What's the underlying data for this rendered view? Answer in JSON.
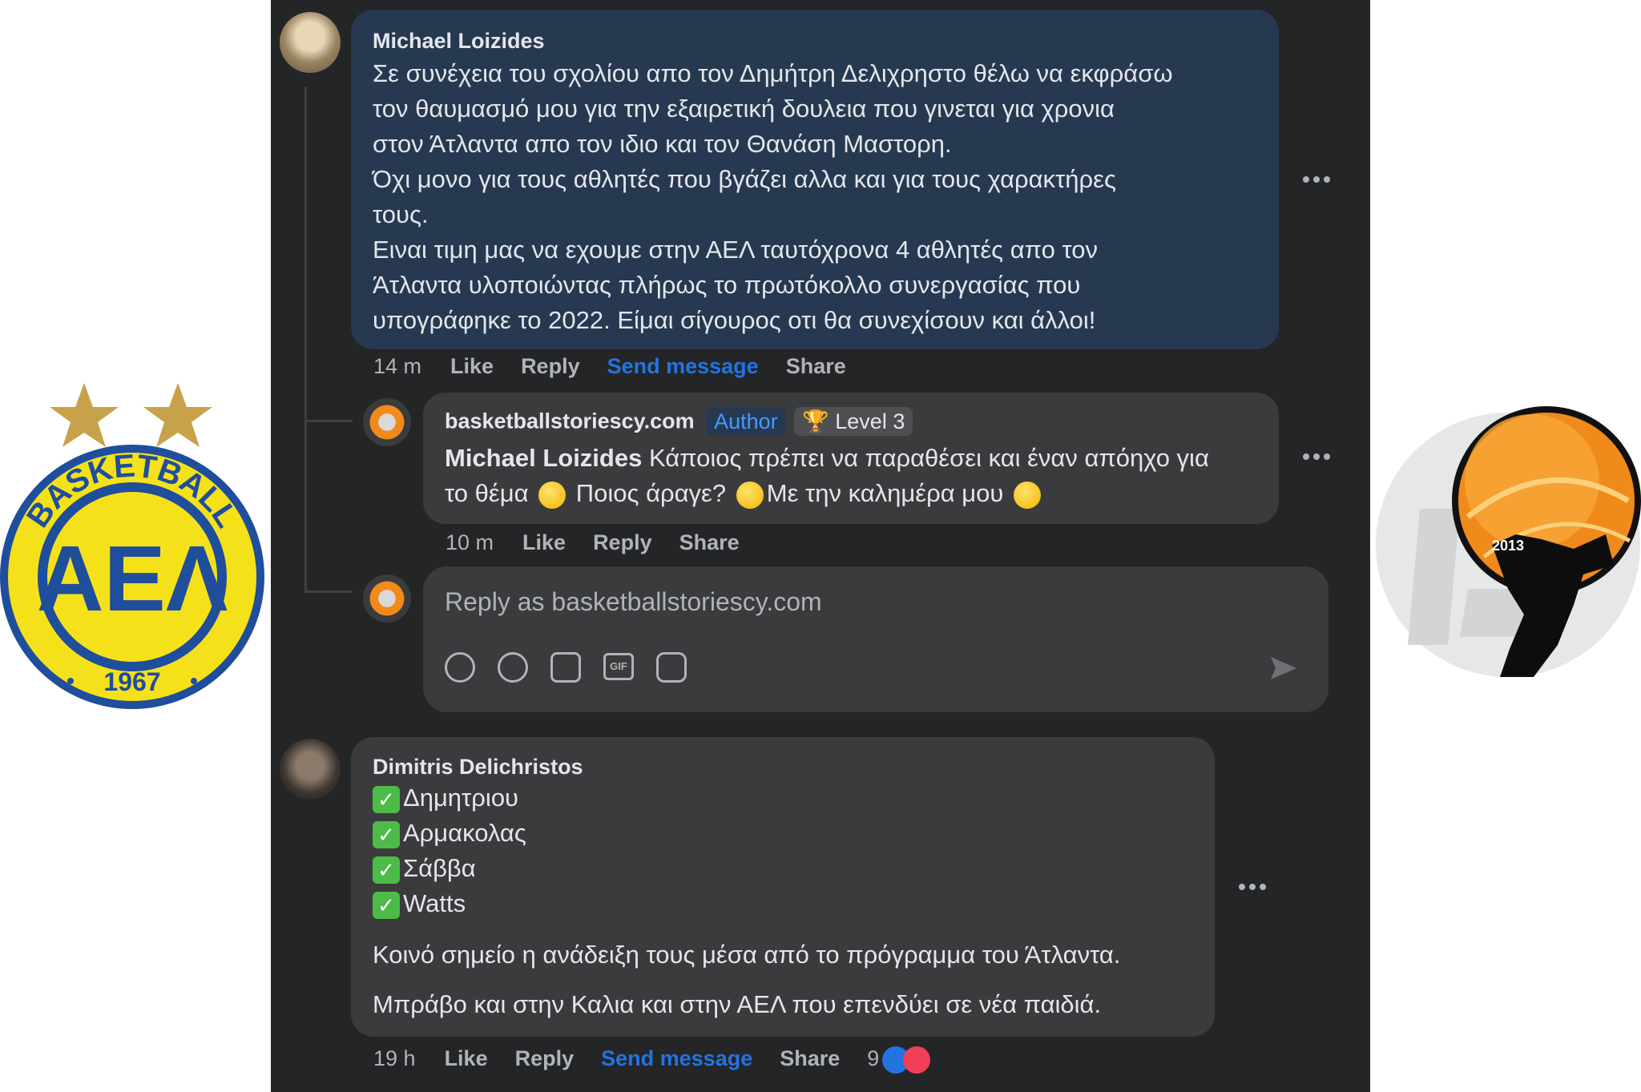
{
  "comments": [
    {
      "author": "Michael Loizides",
      "paragraphs": [
        "Σε συνέχεια του σχολίου απο τον Δημήτρη Δελιχρηστο θέλω να εκφράσω",
        "τον θαυμασμό μου για την εξαιρετική δουλεια που γινεται για χρονια",
        "στον Άτλαντα απο τον ιδιο και τον Θανάση Μαστορη.",
        "Όχι μονο για τους αθλητές που βγάζει αλλα και για τους χαρακτήρες",
        "τους.",
        "Ειναι τιμη μας να εχουμε στην ΑΕΛ ταυτόχρονα 4 αθλητές απο τον",
        "Άτλαντα υλοποιώντας πλήρως το πρωτόκολλο συνεργασίας που",
        "υπογράφηκε το 2022. Είμαι σίγουρος οτι θα συνεχίσουν και άλλοι!"
      ],
      "time": "14 m",
      "like": "Like",
      "reply": "Reply",
      "send_message": "Send message",
      "share": "Share"
    },
    {
      "author": "basketballstoriescy.com",
      "author_badge": "Author",
      "level_badge": "Level 3",
      "mention": "Michael Loizides",
      "line1_rest": " Κάποιος πρέπει να παραθέσει και έναν απόηχο για",
      "line2_a": "το θέμα",
      "line2_b": "Ποιος άραγε?",
      "line2_c": "Με την καλημέρα μου",
      "time": "10 m",
      "like": "Like",
      "reply": "Reply",
      "share": "Share"
    },
    {
      "author": "Dimitris Delichristos",
      "checklist": [
        "Δημητριου",
        "Αρμακολας",
        "Σάββα",
        "Watts"
      ],
      "paragraph1": "Κοινό σημείο η ανάδειξη τους μέσα από το πρόγραμμα του Άτλαντα.",
      "paragraph2": "Μπράβο και στην Καλια και στην ΑΕΛ που επενδύει σε νέα παιδιά.",
      "time": "19 h",
      "like": "Like",
      "reply": "Reply",
      "send_message": "Send message",
      "share": "Share",
      "reaction_count": "9"
    }
  ],
  "reply_box": {
    "placeholder": "Reply as basketballstoriescy.com",
    "tools": [
      "avatar-sticker-icon",
      "emoji-icon",
      "camera-icon",
      "gif-icon",
      "sticker-icon"
    ],
    "gif_label": "GIF"
  },
  "logos": {
    "left": {
      "top_text": "BASKETBALL",
      "center_text": "ΑΕΛ",
      "year": "1967"
    },
    "right": {
      "year": "2013"
    }
  },
  "colors": {
    "panel_bg": "#242526",
    "highlight_bubble": "#263951",
    "bubble": "#3a3b3c",
    "link_blue": "#2374e1",
    "text": "#e4e6eb",
    "muted": "#b0b3b8",
    "ael_yellow": "#f5e11a",
    "ael_blue": "#1f4e9c",
    "star_gold": "#c8a24a"
  }
}
